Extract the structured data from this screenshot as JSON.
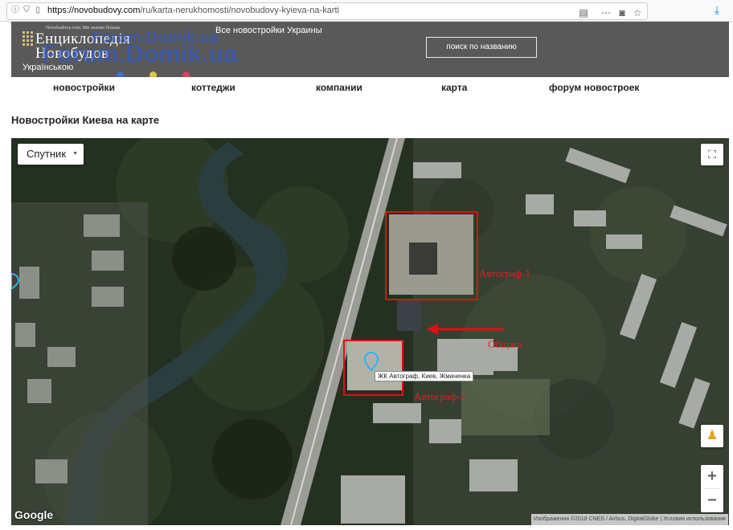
{
  "browser": {
    "url_host": "https://novobudovy.com",
    "url_path": "/ru/karta-nerukhomosti/novobudovy-kyieva-na-karti",
    "icons": [
      "info-icon",
      "shield-icon",
      "page-icon",
      "reader-icon",
      "more-icon",
      "pocket-icon",
      "bookmark-star-icon",
      "download-icon"
    ]
  },
  "header": {
    "logo_tagline": "Novobudovy.com. Ми знаємо більше",
    "logo_line1": "Енциклопедія",
    "logo_line2": "Новобудов",
    "language_link": "Українською",
    "all_ukraine_link": "Все новостройки Украины",
    "search_button": "поиск по названию",
    "watermark_top": "Forum.Domik.ua",
    "watermark_main": "Forum.Domik.ua",
    "watermark_dot_colors": [
      "#3b6fd1",
      "#d8c840",
      "#d84060"
    ]
  },
  "nav": {
    "items": [
      "новостройки",
      "коттеджи",
      "компании",
      "карта",
      "форум новостроек"
    ]
  },
  "page": {
    "title": "Новостройки Киева на карте"
  },
  "map": {
    "map_type": "Спутник",
    "marker_label": "ЖК Автограф, Киев, Жмаченка",
    "annotations": {
      "avtograf1": "Автограф-1",
      "obshaga": "Общага",
      "avtograf2": "Автограф-2"
    },
    "google_logo": "Google",
    "attribution": "Изображения ©2018 CNES / Airbus, DigitalGlobe  |  Условия использования",
    "accent_red": "#e01010"
  }
}
